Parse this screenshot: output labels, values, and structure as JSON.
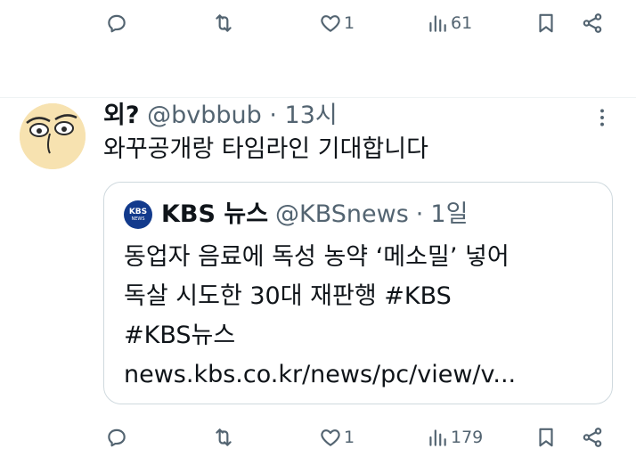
{
  "top_actions": {
    "reply": {
      "icon": "reply-icon"
    },
    "retweet": {
      "icon": "retweet-icon"
    },
    "like": {
      "icon": "heart-icon",
      "count": "1"
    },
    "views": {
      "icon": "views-icon",
      "count": "61"
    },
    "bookmark": {
      "icon": "bookmark-icon"
    },
    "share": {
      "icon": "share-icon"
    }
  },
  "tweet": {
    "display_name": "외?",
    "handle": "@bvbbub",
    "separator": "·",
    "time": "13시",
    "text": "와꾸공개랑 타임라인 기대합니다"
  },
  "quote": {
    "logo_text": "KBS",
    "logo_subtext": "NEWS",
    "name": "KBS 뉴스",
    "handle": "@KBSnews",
    "separator": "·",
    "time": "1일",
    "lines": [
      "동업자 음료에 독성 농약 ‘메소밀’ 넣어",
      "독살 시도한 30대 재판행 #KBS",
      "#KBS뉴스",
      "news.kbs.co.kr/news/pc/view/v..."
    ]
  },
  "bottom_actions": {
    "like_count": "1",
    "views_count": "179"
  },
  "colors": {
    "icon_gray": "#536471",
    "text": "#0f1419",
    "border": "#cfd9de",
    "kbs_blue": "#123a8c"
  }
}
